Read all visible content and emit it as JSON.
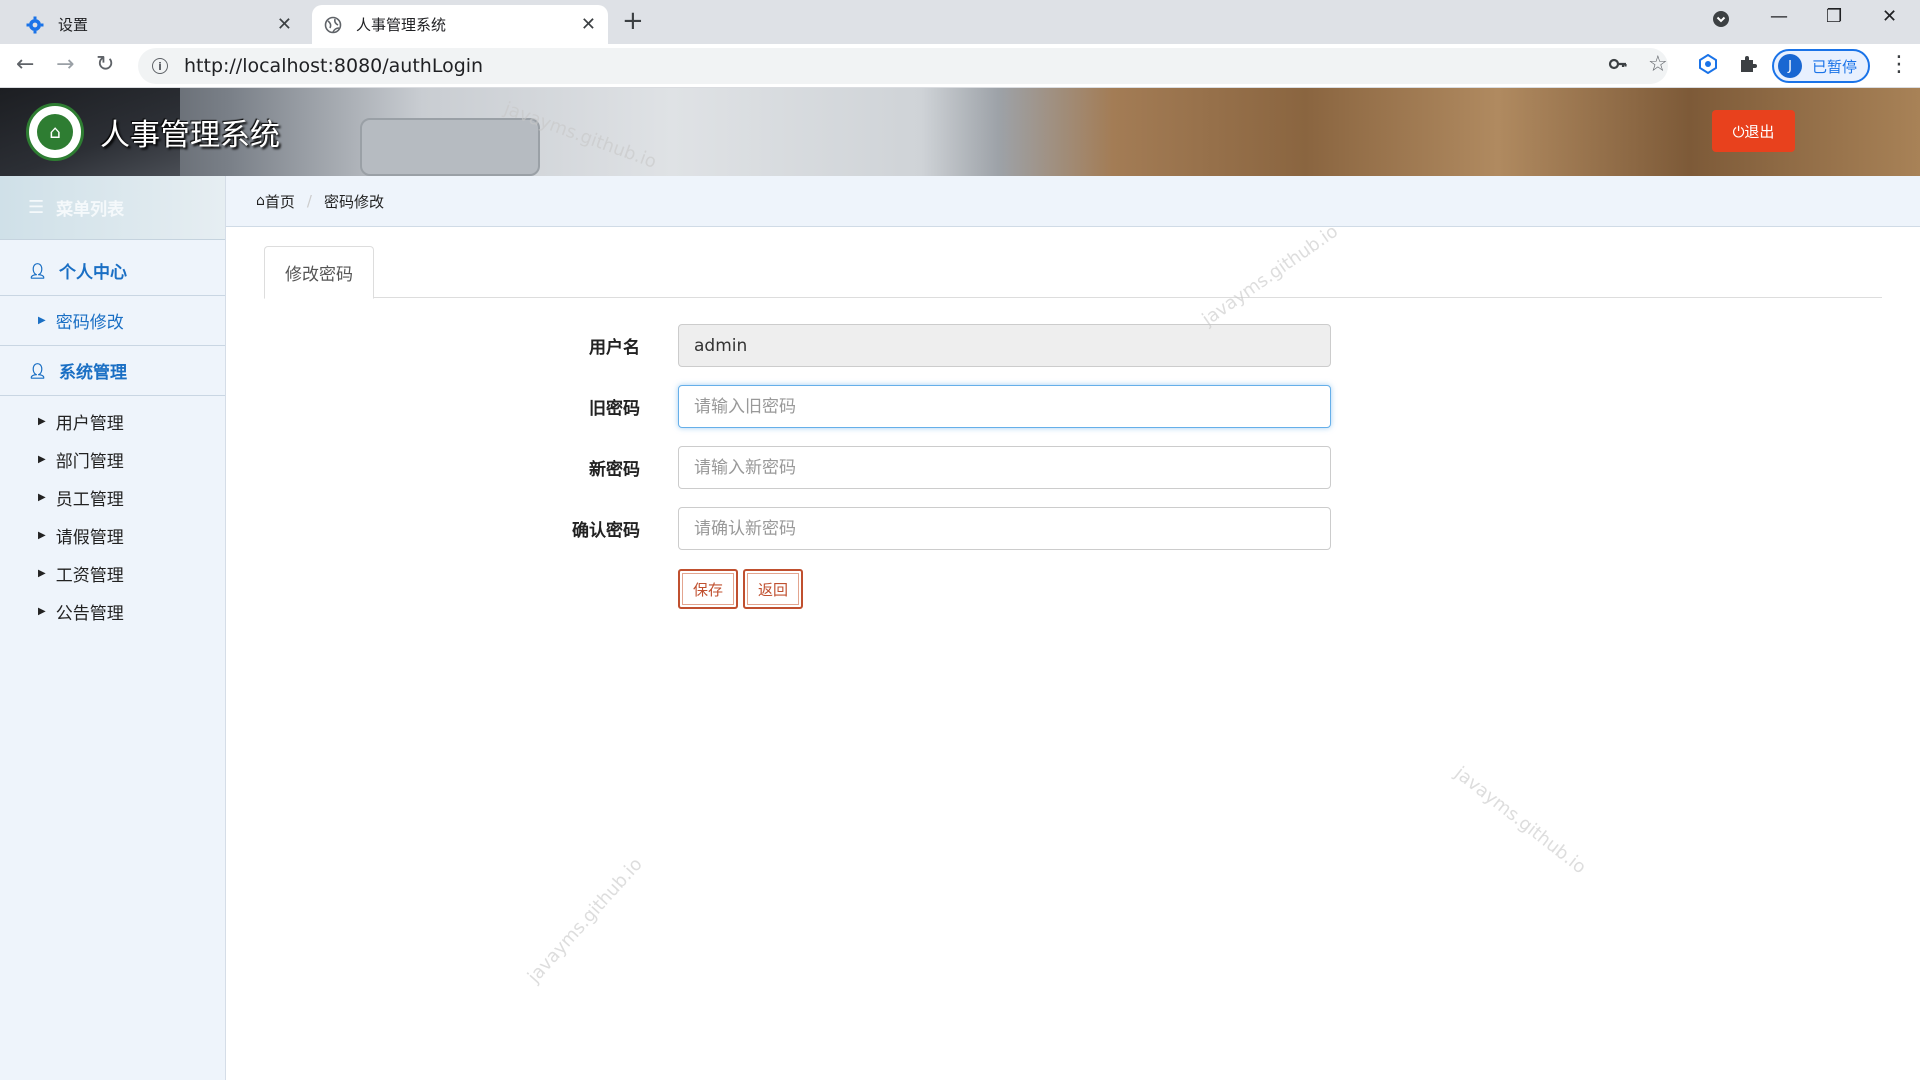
{
  "browser": {
    "tabs": [
      {
        "title": "设置",
        "icon": "gear-icon",
        "active": false
      },
      {
        "title": "人事管理系统",
        "icon": "globe-icon",
        "active": true
      }
    ],
    "url": "http://localhost:8080/authLogin",
    "profile_initial": "J",
    "profile_status": "已暂停"
  },
  "header": {
    "app_title": "人事管理系统",
    "logout_label": "⏻退出"
  },
  "sidebar": {
    "menu_title": "菜单列表",
    "groups": [
      {
        "label": "个人中心",
        "items": [
          {
            "label": "密码修改",
            "active": true
          }
        ]
      },
      {
        "label": "系统管理",
        "items": [
          {
            "label": "用户管理"
          },
          {
            "label": "部门管理"
          },
          {
            "label": "员工管理"
          },
          {
            "label": "请假管理"
          },
          {
            "label": "工资管理"
          },
          {
            "label": "公告管理"
          }
        ]
      }
    ]
  },
  "breadcrumb": {
    "home": "首页",
    "current": "密码修改"
  },
  "content": {
    "tab_label": "修改密码",
    "form": {
      "username_label": "用户名",
      "username_value": "admin",
      "old_label": "旧密码",
      "old_placeholder": "请输入旧密码",
      "new_label": "新密码",
      "new_placeholder": "请输入新密码",
      "confirm_label": "确认密码",
      "confirm_placeholder": "请确认新密码",
      "save_label": "保存",
      "back_label": "返回"
    }
  },
  "watermark": "javayms.github.io",
  "colors": {
    "accent": "#1a6fc4",
    "logout": "#e8411d",
    "button": "#c0502f"
  }
}
